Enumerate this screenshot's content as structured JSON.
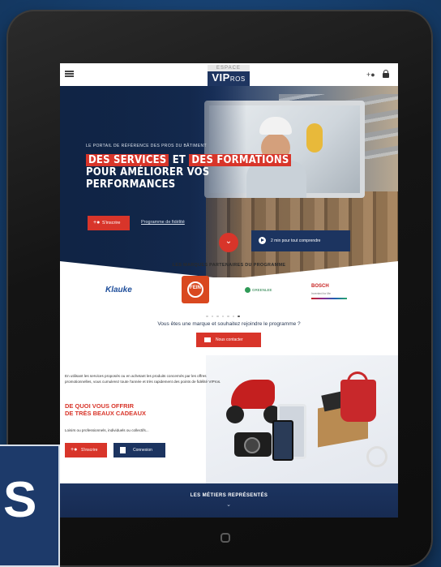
{
  "topbar": {
    "logo_top": "ESPACE",
    "logo_main": "VIP",
    "logo_suffix": "ROS"
  },
  "hero": {
    "kicker": "LE PORTAIL DE RÉFÉRENCE DES PROS DU BÂTIMENT",
    "line1_a": "DES SERVICES",
    "line1_b": " ET ",
    "line1_c": "DES FORMATIONS",
    "line2": "POUR AMÉLIORER VOS",
    "line3": "PERFORMANCES",
    "cta_label": "S'inscrire",
    "link_label": "Programme de fidélité",
    "video_label": "2 min pour tout comprendre"
  },
  "brands": {
    "title": "LES MARQUES PARTENAIRES DU PROGRAMME",
    "items": [
      "Klauke",
      "FEIN",
      "GREENLEE",
      "BOSCH"
    ],
    "bosch_sub": "Invented for life"
  },
  "join": {
    "question": "Vous êtes une marque et souhaitez rejoindre le programme ?",
    "contact_label": "Nous contacter"
  },
  "gifts": {
    "text": "En utilisant les services proposés ou en achetant les produits concernés par les offres promotionnelles, vous cumulerez toute l'année et très rapidement des points de fidélité VIPros.",
    "title_line1": "DE QUOI VOUS OFFRIR",
    "title_line2": "DE TRÈS BEAUX CADEAUX",
    "subtitle": "Loisirs ou professionnels, individuels ou collectifs...",
    "signup_label": "S'inscrire",
    "login_label": "Connexion"
  },
  "metiers": {
    "title": "LES MÉTIERS REPRÉSENTÉS"
  },
  "badge": {
    "letter": "S"
  },
  "colors": {
    "accent_red": "#d8352a",
    "navy": "#1c3460",
    "background_blue": "#17406f"
  }
}
